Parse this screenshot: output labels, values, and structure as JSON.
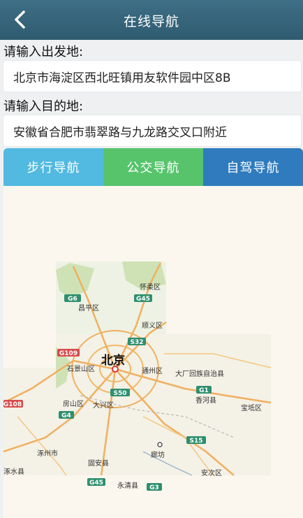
{
  "header": {
    "title": "在线导航",
    "back_icon": "back-chevron-icon"
  },
  "form": {
    "start_label": "请输入出发地:",
    "start_value": "北京市海淀区西北旺镇用友软件园中区8B",
    "dest_label": "请输入目的地:",
    "dest_value": "安徽省合肥市翡翠路与九龙路交叉口附近"
  },
  "modes": [
    {
      "label": "步行导航",
      "color": "#52b9e0"
    },
    {
      "label": "公交导航",
      "color": "#57c46c"
    },
    {
      "label": "自驾导航",
      "color": "#2f7bbd"
    }
  ],
  "map": {
    "city_label": "北京",
    "place_labels": [
      "怀柔区",
      "昌平区",
      "顺义区",
      "石景山区",
      "通州区",
      "大厂回族自治县",
      "香河县",
      "宝坻区",
      "房山区",
      "大兴区",
      "涿州市",
      "固安县",
      "廊坊",
      "永清县",
      "涿水县",
      "安次区"
    ],
    "road_shields": [
      "G6",
      "G45",
      "G109",
      "S32",
      "S50",
      "G1",
      "G4",
      "S15",
      "G45",
      "G3",
      "G108"
    ]
  }
}
